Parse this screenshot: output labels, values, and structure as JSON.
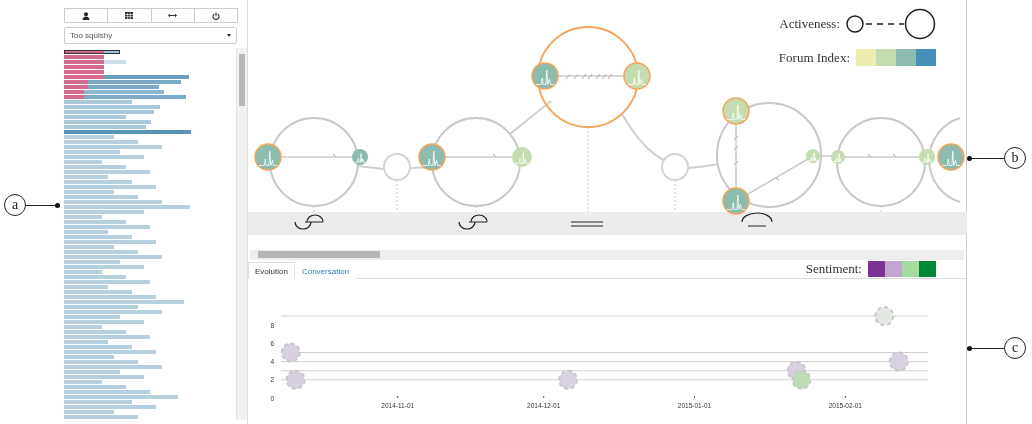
{
  "topic_select": {
    "value": "Too squishy"
  },
  "legend": {
    "activeness_label": "Activeness:",
    "forum_index_label": "Forum Index:",
    "forum_index_colors": [
      {
        "color": "#eeeeb0"
      },
      {
        "color": "#c4dcb0"
      },
      {
        "color": "#8cbcb0"
      },
      {
        "color": "#4490b8"
      }
    ]
  },
  "tabs": [
    {
      "label": "Evolution",
      "selected": true
    },
    {
      "label": "Conversation",
      "selected": false
    }
  ],
  "sentiment": {
    "label": "Sentiment:",
    "colors": [
      {
        "color": "#7b3294"
      },
      {
        "color": "#c2a5cf"
      },
      {
        "color": "#a6dba0"
      },
      {
        "color": "#008837"
      }
    ]
  },
  "chart_data": {
    "type": "scatter",
    "x": [
      "2014-10-11",
      "2014-10-10",
      "2014-12-06",
      "2015-01-22",
      "2015-01-23",
      "2015-02-12",
      "2015-02-09"
    ],
    "xlim": [
      "2014-10-08",
      "2015-02-18"
    ],
    "ylim": [
      0,
      9
    ],
    "xticks": [
      "2014-11-01",
      "2014-12-01",
      "2015-01-01",
      "2015-02-01"
    ],
    "yticks": [
      0,
      2,
      4,
      6,
      8
    ],
    "series": [
      {
        "color": "#d9cfe3",
        "values": [
          2,
          5,
          null,
          3,
          null,
          4,
          null
        ]
      },
      {
        "color": "#d9d2e3",
        "values": [
          null,
          null,
          2,
          null,
          null,
          null,
          null
        ]
      },
      {
        "color": "#bcdcb6",
        "values": [
          null,
          null,
          null,
          null,
          2,
          null,
          null
        ]
      },
      {
        "color": "#e3e8e1",
        "values": [
          null,
          null,
          null,
          null,
          null,
          null,
          9
        ]
      }
    ]
  },
  "callouts": [
    {
      "label": "a"
    },
    {
      "label": "b"
    },
    {
      "label": "c"
    }
  ]
}
